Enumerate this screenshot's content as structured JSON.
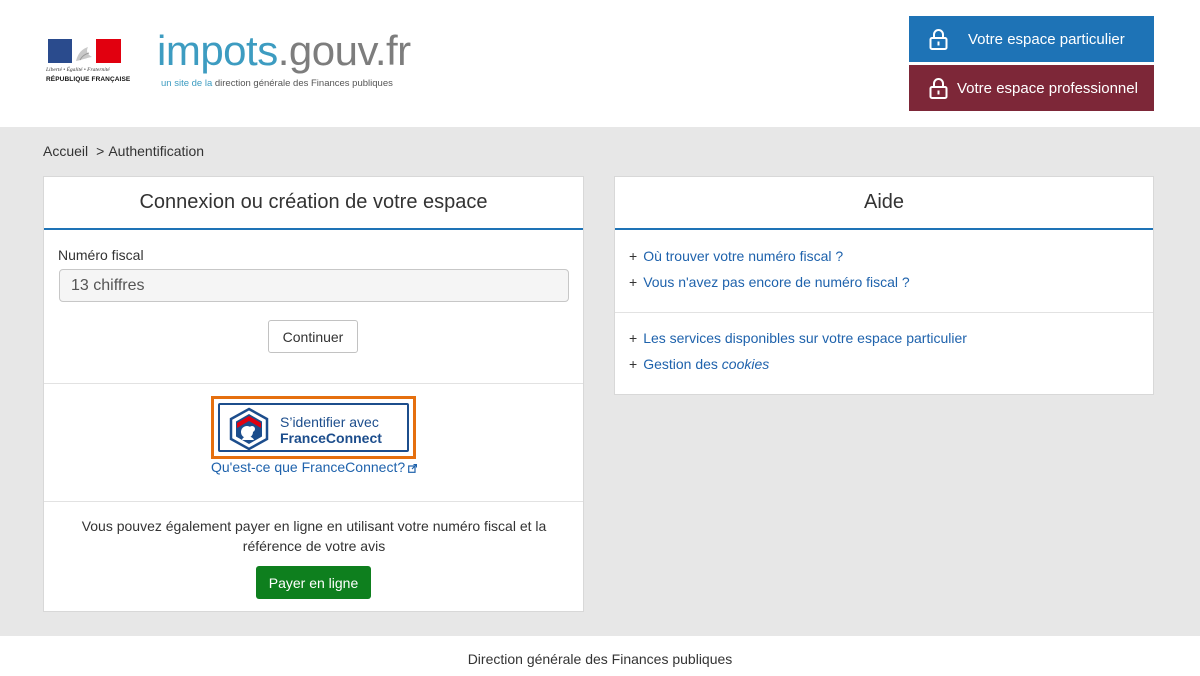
{
  "header": {
    "republic": {
      "motto": "Liberté • Égalité • Fraternité",
      "name": "RÉPUBLIQUE FRANÇAISE"
    },
    "brand": {
      "impots": "impots",
      "gouv": ".gouv.fr"
    },
    "tagline": {
      "prefix": "un site de la",
      "org": "direction générale des Finances publiques"
    },
    "espace_particulier": "Votre espace particulier",
    "espace_professionnel": "Votre espace professionnel",
    "colors": {
      "particulier": "#1e73b6",
      "professionnel": "#7d2738"
    }
  },
  "breadcrumb": {
    "home": "Accueil",
    "separator": ">",
    "current": "Authentification"
  },
  "login_panel": {
    "title": "Connexion ou création de votre espace",
    "fiscal_label": "Numéro fiscal",
    "fiscal_placeholder": "13 chiffres",
    "fiscal_value": "",
    "continue_label": "Continuer",
    "franceconnect": {
      "line1": "S’identifier avec",
      "line2": "FranceConnect",
      "info_link": "Qu'est-ce que FranceConnect?"
    },
    "pay_text": "Vous pouvez également payer en ligne en utilisant votre numéro fiscal et la référence de votre avis",
    "pay_button": "Payer en ligne"
  },
  "help_panel": {
    "title": "Aide",
    "group1": [
      "Où trouver votre numéro fiscal ?",
      "Vous n'avez pas encore de numéro fiscal ?"
    ],
    "group2_item1": "Les services disponibles sur votre espace particulier",
    "cookies_prefix": "Gestion des",
    "cookies_word": "cookies",
    "plus": "+"
  },
  "footer": {
    "text": "Direction générale des Finances publiques"
  }
}
